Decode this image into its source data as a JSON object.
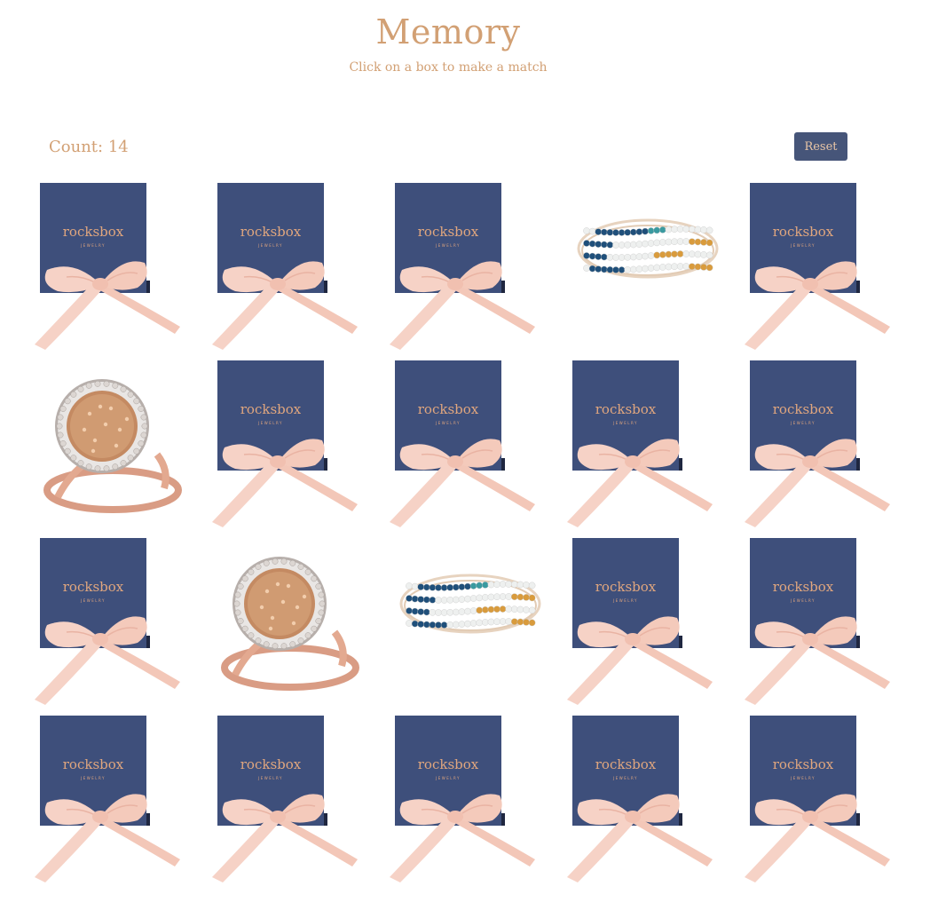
{
  "header": {
    "title": "Memory",
    "subtitle": "Click on a box to make a match"
  },
  "controls": {
    "count_text": "Count: 14",
    "count": 14,
    "reset_label": "Reset"
  },
  "box": {
    "brand": "rocksbox",
    "tagline": "JEWELRY"
  },
  "colors": {
    "accent": "#d2a074",
    "box_navy": "#3e4f7b",
    "ribbon_pink": "#f6d2c6",
    "button": "#465579"
  },
  "board": {
    "columns": 5,
    "rows": 4,
    "cells": [
      {
        "state": "hidden",
        "content": "gift-box"
      },
      {
        "state": "hidden",
        "content": "gift-box"
      },
      {
        "state": "hidden",
        "content": "gift-box"
      },
      {
        "state": "revealed",
        "content": "bracelet"
      },
      {
        "state": "hidden",
        "content": "gift-box"
      },
      {
        "state": "revealed",
        "content": "ring"
      },
      {
        "state": "hidden",
        "content": "gift-box"
      },
      {
        "state": "hidden",
        "content": "gift-box"
      },
      {
        "state": "hidden",
        "content": "gift-box"
      },
      {
        "state": "hidden",
        "content": "gift-box"
      },
      {
        "state": "hidden",
        "content": "gift-box"
      },
      {
        "state": "revealed",
        "content": "ring"
      },
      {
        "state": "revealed",
        "content": "bracelet"
      },
      {
        "state": "hidden",
        "content": "gift-box"
      },
      {
        "state": "hidden",
        "content": "gift-box"
      },
      {
        "state": "hidden",
        "content": "gift-box"
      },
      {
        "state": "hidden",
        "content": "gift-box"
      },
      {
        "state": "hidden",
        "content": "gift-box"
      },
      {
        "state": "hidden",
        "content": "gift-box"
      },
      {
        "state": "hidden",
        "content": "gift-box"
      }
    ]
  }
}
